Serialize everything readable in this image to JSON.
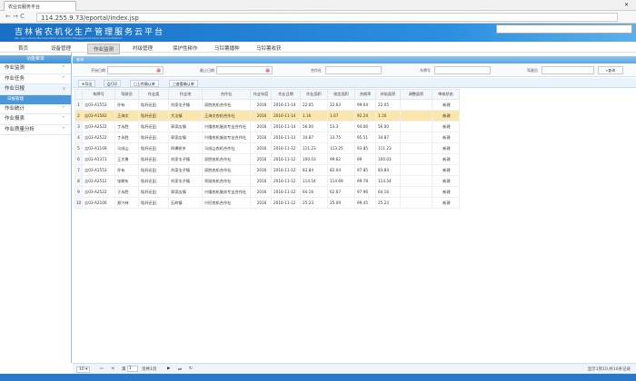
{
  "browser": {
    "tab_title": "农业云服务平台",
    "url": "114.255.9.73/eportal/index.jsp"
  },
  "banner": {
    "title": "吉林省农机化生产管理服务云平台",
    "subtitle": "Jilin Agricultural Mechanization Production Management Cloud Service Platform"
  },
  "nav": [
    "首页",
    "设备管理",
    "作业监测",
    "村级管理",
    "保护性耕作",
    "马铃薯播种",
    "马铃薯收获"
  ],
  "sidebar": {
    "header": "功能菜单",
    "items": [
      {
        "label": "作业监测",
        "chevron": "^"
      },
      {
        "label": "作业任务",
        "chevron": "^"
      },
      {
        "label": "作业日报",
        "chevron": "v"
      }
    ],
    "sub": "日报管理",
    "items2": [
      {
        "label": "作业统计",
        "chevron": "^"
      },
      {
        "label": "作业报表",
        "chevron": "^"
      },
      {
        "label": "作业质量分析",
        "chevron": "^"
      }
    ]
  },
  "query": {
    "title": "查询",
    "start_label": "开始日期",
    "end_label": "截止日期",
    "coop_label": "合作社",
    "plate_label": "车牌号",
    "driver_label": "驾驶员",
    "search": "查询"
  },
  "toolbar": [
    "导出",
    "打印",
    "上传确认单",
    "查看确认单"
  ],
  "grid": {
    "columns": [
      "车牌号",
      "驾驶员",
      "作业类",
      "作业地",
      "合作社",
      "作业年度",
      "作业日期",
      "作业面积",
      "核定面积",
      "合格率",
      "补贴面积",
      "调整面积",
      "审核状态"
    ],
    "rows": [
      [
        "吉03-A1553",
        "孙有",
        "秸秆还田",
        "刘家屯子镇",
        "双胜农机合作社",
        "2016",
        "2016-11-14",
        "22.05",
        "22.63",
        "99.04",
        "22.05",
        "",
        "新建"
      ],
      [
        "吉03-A1583",
        "王海文",
        "秸秆还田",
        "大洼镇",
        "王海文农机合作社",
        "2016",
        "2016-11-14",
        "1.16",
        "1.07",
        "92.24",
        "1.16",
        "",
        "新建"
      ],
      [
        "吉03-A2522",
        "丁永胜",
        "秸秆还田",
        "郭家店镇",
        "兴隆农机服务专业合作社",
        "2016",
        "2016-11-14",
        "56.00",
        "53.3",
        "94.06",
        "56.00",
        "",
        "新建"
      ],
      [
        "吉03-A2522",
        "丁永胜",
        "秸秆还田",
        "郭家店镇",
        "兴隆农机服务专业合作社",
        "2016",
        "2016-11-13",
        "34.87",
        "33.75",
        "95.51",
        "34.87",
        "",
        "新建"
      ],
      [
        "吉03-A1169",
        "马成山",
        "秸秆还田",
        "四棵树乡",
        "马成山农机合作社",
        "2016",
        "2016-11-12",
        "111.23",
        "113.25",
        "93.85",
        "111.23",
        "",
        "新建"
      ],
      [
        "吉03-A1373",
        "王大勇",
        "秸秆还田",
        "刘家屯子镇",
        "双胜农机合作社",
        "2016",
        "2016-11-12",
        "100.03",
        "99.62",
        "99",
        "100.03",
        "",
        "新建"
      ],
      [
        "吉03-A1553",
        "孙有",
        "秸秆还田",
        "刘家屯子镇",
        "双胜农机合作社",
        "2016",
        "2016-11-12",
        "83.84",
        "82.04",
        "97.85",
        "83.84",
        "",
        "新建"
      ],
      [
        "吉03-A2512",
        "张朝东",
        "秸秆还田",
        "刘家屯子镇",
        "秀丽农机合作社",
        "2016",
        "2016-11-12",
        "114.54",
        "114.69",
        "99.78",
        "114.54",
        "",
        "新建"
      ],
      [
        "吉03-A2522",
        "于永胜",
        "秸秆还田",
        "郭家店镇",
        "兴隆农机服务专业合作社",
        "2016",
        "2016-11-12",
        "64.16",
        "62.67",
        "97.96",
        "64.16",
        "",
        "新建"
      ],
      [
        "吉03-A2100",
        "郑兴林",
        "秸秆还田",
        "石岭镇",
        "兴旺农机合作社",
        "2016",
        "2016-11-12",
        "25.23",
        "25.09",
        "99.45",
        "25.23",
        "",
        "新建"
      ]
    ]
  },
  "pager": {
    "page_size": "10 ▾",
    "page_prefix": "第",
    "page": "1",
    "page_suffix": "页共1页",
    "info": "显示1到10,共10条记录"
  }
}
